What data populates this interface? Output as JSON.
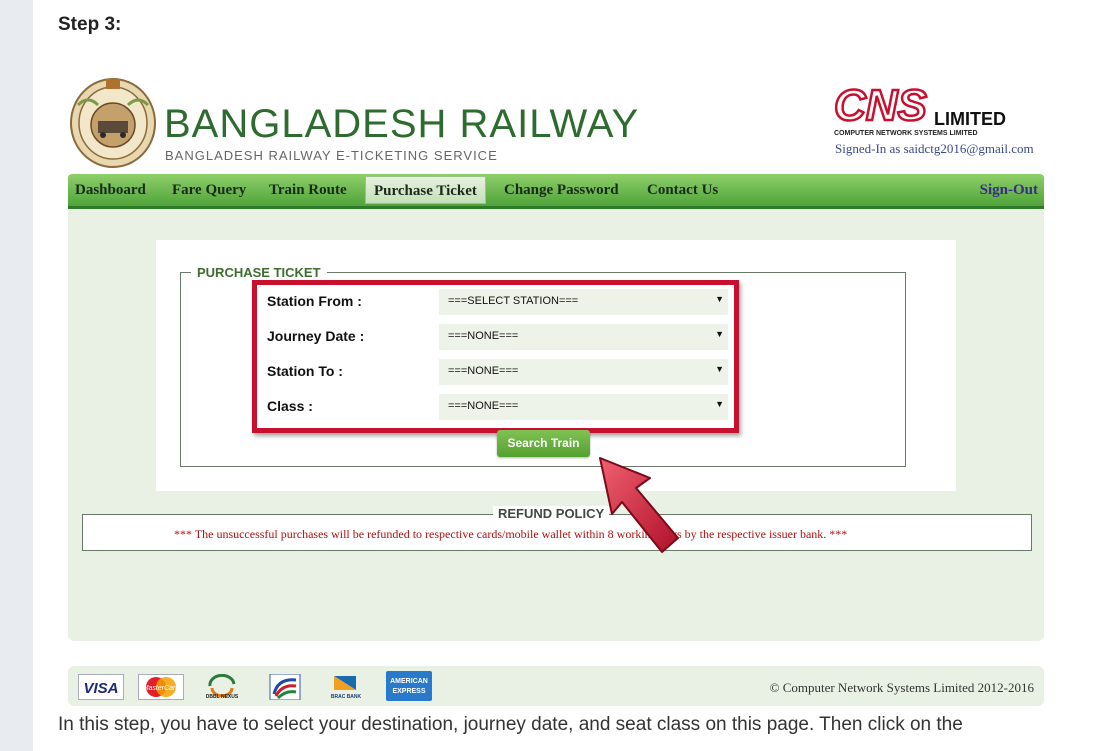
{
  "article": {
    "step_heading": "Step 3:",
    "body_text": "In this step, you have to select your destination, journey date, and seat class on this page. Then click on the"
  },
  "header": {
    "title": "BANGLADESH RAILWAY",
    "subtitle": "BANGLADESH RAILWAY E-TICKETING SERVICE",
    "partner_limited": "LIMITED",
    "partner_full": "COMPUTER NETWORK SYSTEMS LIMITED",
    "signed_in": "Signed-In as saidctg2016@gmail.com"
  },
  "nav": {
    "items": [
      "Dashboard",
      "Fare Query",
      "Train Route",
      "Purchase Ticket",
      "Change Password",
      "Contact Us"
    ],
    "active": "Purchase Ticket",
    "sign_out": "Sign-Out"
  },
  "form": {
    "legend": "PURCHASE TICKET",
    "rows": [
      {
        "label": "Station From :",
        "value": "===SELECT STATION==="
      },
      {
        "label": "Journey Date :",
        "value": "===NONE==="
      },
      {
        "label": "Station To :",
        "value": "===NONE==="
      },
      {
        "label": "Class :",
        "value": "===NONE==="
      }
    ],
    "search_label": "Search Train"
  },
  "refund": {
    "legend": "REFUND POLICY",
    "text": "*** The unsuccessful purchases will be refunded to respective cards/mobile wallet within 8 working days by the respective issuer bank. ***"
  },
  "footer": {
    "payment_methods": [
      "VISA",
      "MasterCard",
      "DBBL NEXUS",
      "bKash",
      "BRAC BANK",
      "AMERICAN EXPRESS"
    ],
    "copyright": "© Computer Network Systems Limited 2012-2016"
  },
  "colors": {
    "nav_green": "#4fa33a",
    "highlight_red": "#c8102e",
    "brand_green": "#2e6b2e",
    "refund_red": "#b01010"
  }
}
